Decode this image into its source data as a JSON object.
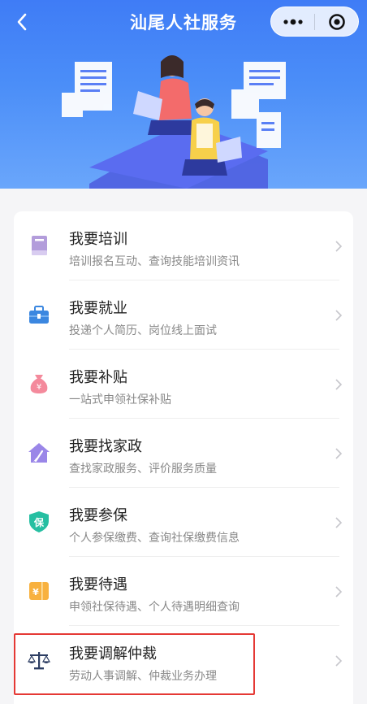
{
  "header": {
    "title": "汕尾人社服务",
    "back_icon": "chevron-left-icon",
    "more_icon": "more-dots-icon",
    "close_icon": "target-icon"
  },
  "colors": {
    "banner": "#3f7cf6",
    "highlight": "#e53935"
  },
  "services": [
    {
      "name": "我要培训",
      "desc": "培训报名互动、查询技能培训资讯",
      "icon": "book-icon",
      "color": "#b39ddb"
    },
    {
      "name": "我要就业",
      "desc": "投递个人简历、岗位线上面试",
      "icon": "briefcase-icon",
      "color": "#3b87e0"
    },
    {
      "name": "我要补贴",
      "desc": "一站式申领社保补贴",
      "icon": "money-bag-icon",
      "color": "#f48a9c"
    },
    {
      "name": "我要找家政",
      "desc": "查找家政服务、评价服务质量",
      "icon": "house-broom-icon",
      "color": "#9a86e8"
    },
    {
      "name": "我要参保",
      "desc": "个人参保缴费、查询社保缴费信息",
      "icon": "shield-insurance-icon",
      "color": "#26bfa2"
    },
    {
      "name": "我要待遇",
      "desc": "申领社保待遇、个人待遇明细查询",
      "icon": "yen-ticket-icon",
      "color": "#f8b13f"
    },
    {
      "name": "我要调解仲裁",
      "desc": "劳动人事调解、仲裁业务办理",
      "icon": "scales-icon",
      "color": "#2d3e63"
    }
  ]
}
